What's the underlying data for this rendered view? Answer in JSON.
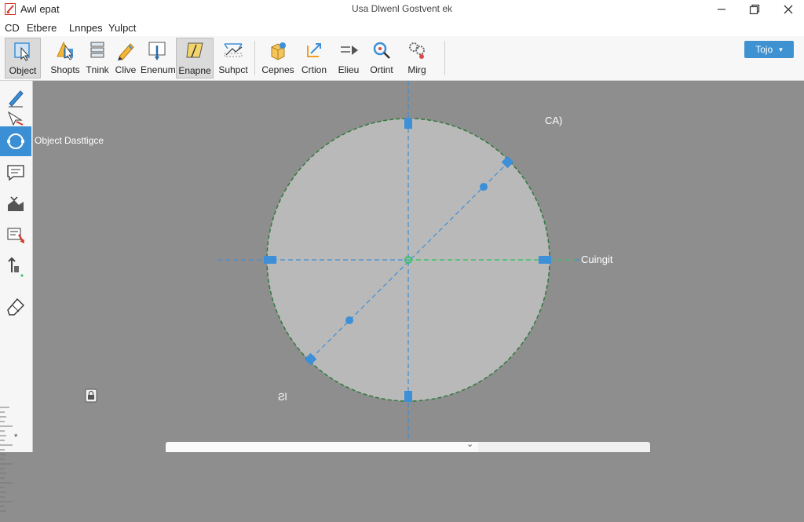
{
  "window": {
    "app_title": "Awl epat",
    "document_title": "Usa Dlwenl Gostvent ek",
    "minimize_glyph": "—",
    "close_glyph": "✕"
  },
  "menu": {
    "items": [
      "CD",
      "Etbere",
      "Lnnpes",
      "Yulpct"
    ]
  },
  "ribbon": {
    "tools": [
      {
        "label": "Object",
        "icon": "select-object-icon"
      },
      {
        "label": "Shopts",
        "icon": "shapes-icon"
      },
      {
        "label": "Tnink",
        "icon": "layers-icon"
      },
      {
        "label": "Clive",
        "icon": "pencil-icon"
      },
      {
        "label": "Enenum",
        "icon": "pin-icon"
      },
      {
        "label": "Enapne",
        "icon": "edit-shape-icon"
      },
      {
        "label": "Suhpct",
        "icon": "transform-icon"
      },
      {
        "label": "Cepnes",
        "icon": "box-icon"
      },
      {
        "label": "Crtion",
        "icon": "arrow-corner-icon"
      },
      {
        "label": "Elieu",
        "icon": "move-arrow-icon"
      },
      {
        "label": "Ortint",
        "icon": "magnet-icon"
      },
      {
        "label": "Mirg",
        "icon": "settings-cluster-icon"
      }
    ],
    "topo_button": {
      "label": "Tojo",
      "caret": "▾"
    }
  },
  "left_panel": {
    "tools": [
      "pen-icon",
      "arrow-select-icon",
      "circle-tool-icon",
      "comment-icon",
      "node-edit-icon",
      "measure-icon",
      "anchor-icon",
      "eraser-icon"
    ],
    "tooltip": "Object Dasttigce",
    "ruler_marker": "*"
  },
  "canvas": {
    "labels": {
      "top_right": "CA)",
      "right": "Cuingit",
      "bottom_left": "Ƨl"
    },
    "colors": {
      "background": "#8e8e8e",
      "circle_fill": "#b9b9b9",
      "guide_blue": "#3d8fd8",
      "guide_green": "#3cc36a",
      "handle_blue": "#3d8fd8"
    }
  },
  "scrollbar": {
    "caret": "⌄"
  }
}
